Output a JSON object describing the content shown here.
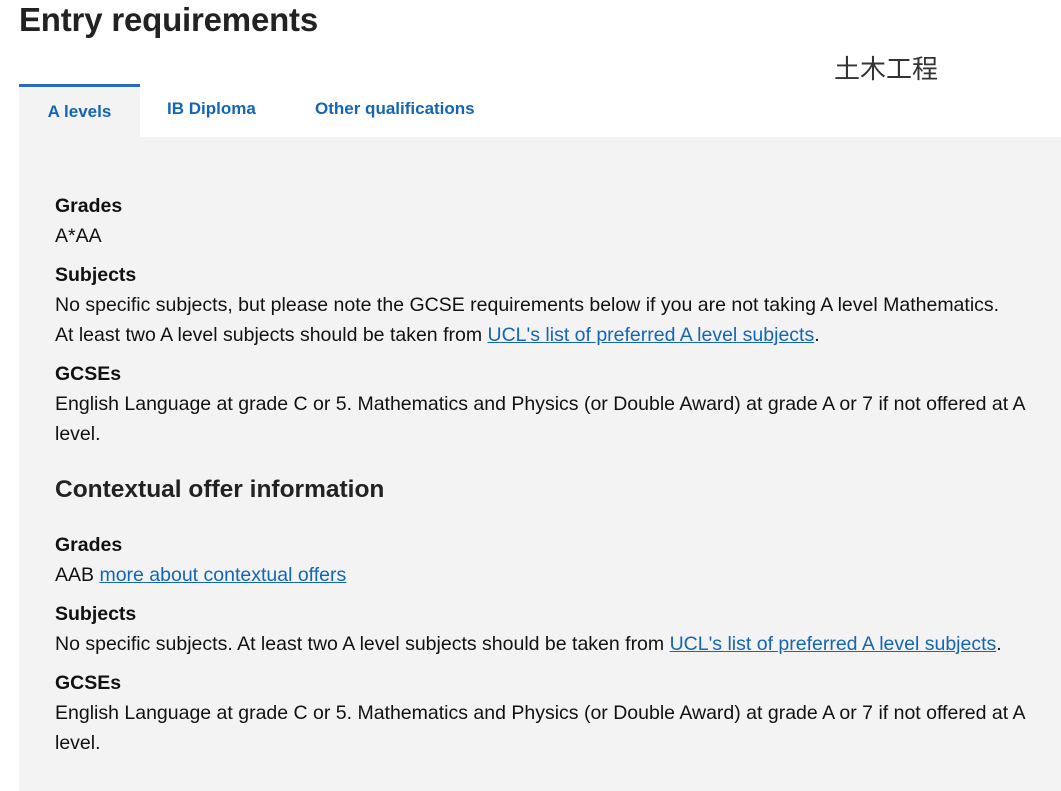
{
  "page": {
    "title": "Entry requirements",
    "overlay_text": "土木工程"
  },
  "tabs": [
    {
      "label": "A levels",
      "active": true
    },
    {
      "label": "IB Diploma",
      "active": false
    },
    {
      "label": "Other qualifications",
      "active": false
    }
  ],
  "standard": {
    "grades_label": "Grades",
    "grades_value": "A*AA",
    "subjects_label": "Subjects",
    "subjects_line1": "No specific subjects, but please note the GCSE requirements below if you are not taking A level Mathematics.",
    "subjects_line2_prefix": "At least two A level subjects should be taken from ",
    "subjects_link": "UCL's list of preferred A level subjects",
    "subjects_line2_suffix": ".",
    "gcses_label": "GCSEs",
    "gcses_value": "English Language at grade C or 5. Mathematics and Physics (or Double Award) at grade A or 7 if not offered at A level."
  },
  "contextual": {
    "heading": "Contextual offer information",
    "grades_label": "Grades",
    "grades_value": "AAB",
    "grades_link": "more about contextual offers",
    "subjects_label": "Subjects",
    "subjects_prefix": "No specific subjects. At least two A level subjects should be taken from ",
    "subjects_link": "UCL's list of preferred A level subjects",
    "subjects_suffix": ".",
    "gcses_label": "GCSEs",
    "gcses_value": "English Language at grade C or 5. Mathematics and Physics (or Double Award) at grade A or 7 if not offered at A level."
  },
  "colors": {
    "link": "#1466b5",
    "panel_bg": "#f3f3f3",
    "active_tab_border": "#2b6cb8"
  }
}
